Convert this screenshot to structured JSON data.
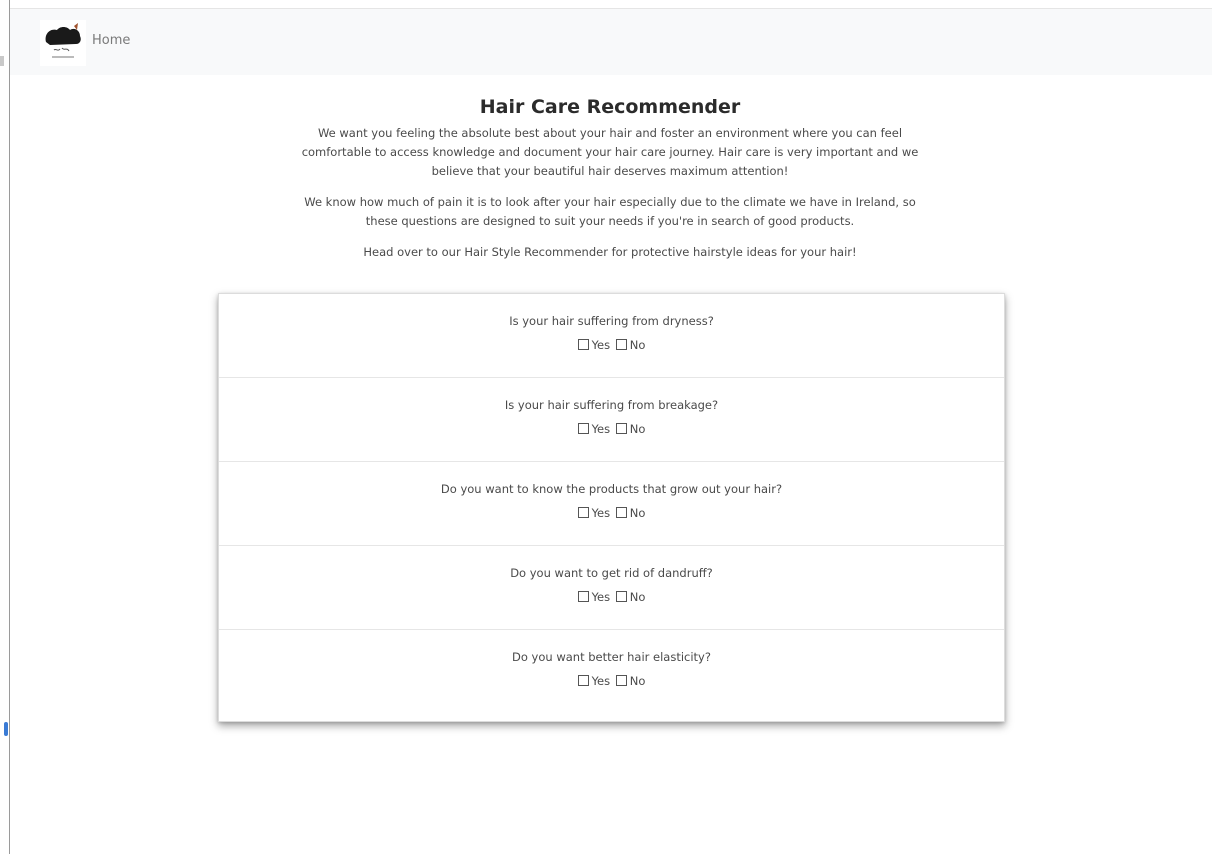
{
  "nav": {
    "home_label": "Home"
  },
  "header": {
    "title": "Hair Care Recommender",
    "paragraphs": [
      "We want you feeling the absolute best about your hair and foster an environment where you can feel comfortable to access knowledge and document your hair care journey. Hair care is very important and we believe that your beautiful hair deserves maximum attention!",
      "We know how much of pain it is to look after your hair especially due to the climate we have in Ireland, so these questions are designed to suit your needs if you're in search of good products.",
      "Head over to our Hair Style Recommender for protective hairstyle ideas for your hair!"
    ]
  },
  "questions": [
    {
      "text": "Is your hair suffering from dryness?",
      "yes": "Yes",
      "no": "No"
    },
    {
      "text": "Is your hair suffering from breakage?",
      "yes": "Yes",
      "no": "No"
    },
    {
      "text": "Do you want to know the products that grow out your hair?",
      "yes": "Yes",
      "no": "No"
    },
    {
      "text": "Do you want to get rid of dandruff?",
      "yes": "Yes",
      "no": "No"
    },
    {
      "text": "Do you want better hair elasticity?",
      "yes": "Yes",
      "no": "No"
    }
  ],
  "colors": {
    "navbar_bg": "#f8f9fa",
    "text": "#4a4a4a",
    "title": "#2b2b2b"
  }
}
